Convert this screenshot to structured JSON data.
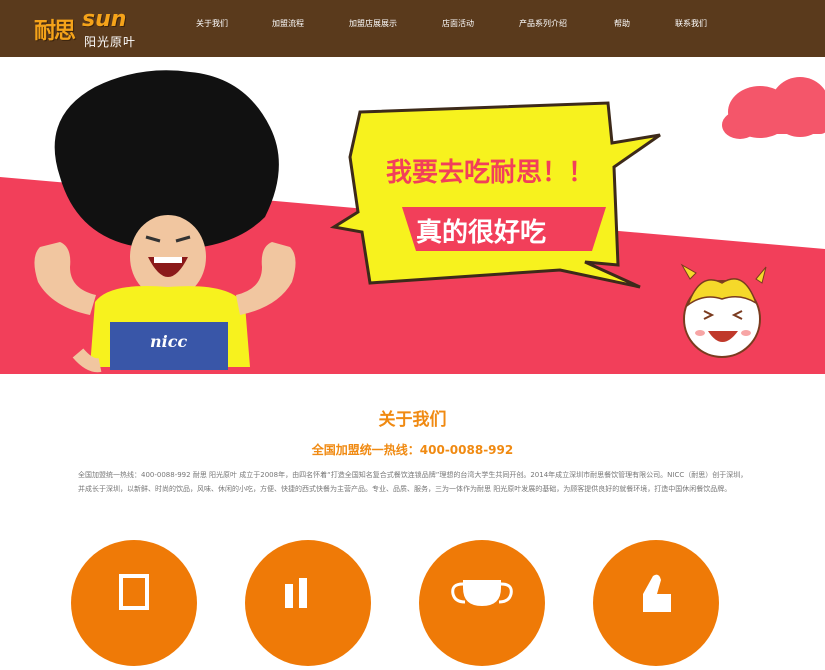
{
  "nav": {
    "logo_main": "耐思",
    "logo_sun": "sun",
    "logo_sub": "阳光原叶",
    "items": [
      "关于我们",
      "加盟流程",
      "加盟店展展示",
      "店面活动",
      "产品系列介绍",
      "帮助",
      "联系我们"
    ]
  },
  "hero": {
    "bubble_line1": "我要去吃耐思！！",
    "bubble_line2": "真的很好吃",
    "shirt_text": "nicc"
  },
  "about": {
    "title": "关于我们",
    "hotline": "全国加盟统一热线：400-0088-992",
    "description": "全国加盟统一热线：400-0088-992 耐思 阳光原叶 成立于2008年，由四名怀着“打造全国知名复合式餐饮连锁品牌”理想的台湾大学生共同开创。2014年成立深圳市耐思餐饮管理有限公司。NICC（耐思）创于深圳，并成长于深圳，以新鲜、时尚的饮品，风味、休闲的小吃，方便、快捷的西式快餐为主营产品。专业、品质、服务，三为一体作为耐思 阳光原叶发展的基础，为顾客提供良好的就餐环境，打造中国休闲餐饮品牌。"
  },
  "features": [
    {
      "icon": "document-icon"
    },
    {
      "icon": "chart-icon"
    },
    {
      "icon": "trophy-icon"
    },
    {
      "icon": "thumbs-up-icon"
    }
  ],
  "colors": {
    "nav_bg": "#5a3a1c",
    "accent": "#ef7a07",
    "hero_red": "#f23f5a",
    "bubble_yellow": "#f7f21e"
  }
}
